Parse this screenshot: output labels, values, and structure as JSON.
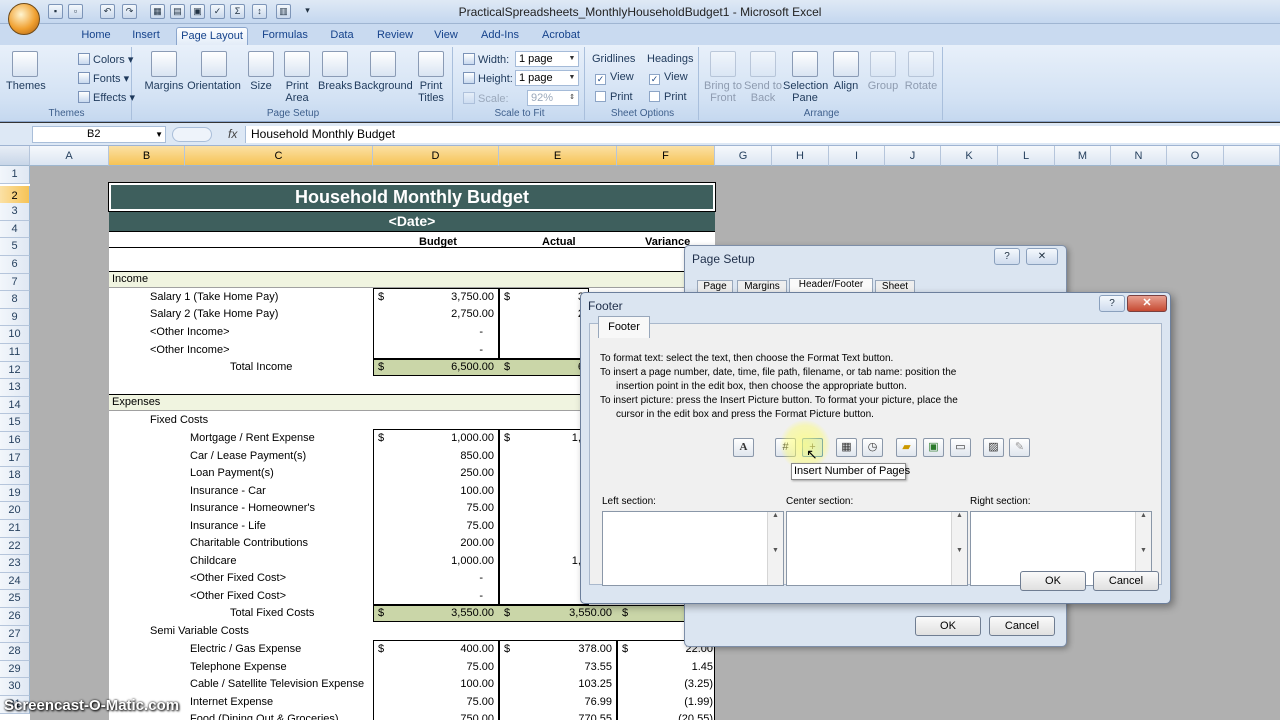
{
  "window": {
    "title": "PracticalSpreadsheets_MonthlyHouseholdBudget1 - Microsoft Excel",
    "qat": [
      "save-icon",
      "pdf-icon",
      "undo-icon",
      "redo-icon",
      "sort-icon",
      "open-icon",
      "print-preview-icon",
      "spellcheck-icon",
      "sum-icon",
      "sort-asc-icon",
      "insert-icon",
      "customize-icon"
    ]
  },
  "ribbon": {
    "tabs": [
      "Home",
      "Insert",
      "Page Layout",
      "Formulas",
      "Data",
      "Review",
      "View",
      "Add-Ins",
      "Acrobat"
    ],
    "active_tab": "Page Layout",
    "themes": {
      "label": "Themes",
      "colors": "Colors",
      "fonts": "Fonts",
      "effects": "Effects",
      "group": "Themes"
    },
    "page_setup": {
      "margins": "Margins",
      "orientation": "Orientation",
      "size": "Size",
      "print_area_1": "Print",
      "print_area_2": "Area",
      "breaks": "Breaks",
      "background": "Background",
      "print_titles_1": "Print",
      "print_titles_2": "Titles",
      "group": "Page Setup"
    },
    "scale_to_fit": {
      "width_label": "Width:",
      "width_value": "1 page",
      "height_label": "Height:",
      "height_value": "1 page",
      "scale_label": "Scale:",
      "scale_value": "92%",
      "group": "Scale to Fit"
    },
    "sheet_options": {
      "gridlines": "Gridlines",
      "headings": "Headings",
      "view": "View",
      "print": "Print",
      "group": "Sheet Options"
    },
    "arrange": {
      "bring_1": "Bring to",
      "bring_2": "Front",
      "send_1": "Send to",
      "send_2": "Back",
      "selection_1": "Selection",
      "selection_2": "Pane",
      "align": "Align",
      "grp": "Group",
      "rotate": "Rotate",
      "group": "Arrange"
    }
  },
  "formula_bar": {
    "name_box": "B2",
    "fx": "fx",
    "formula": "Household Monthly Budget"
  },
  "columns": [
    "A",
    "B",
    "C",
    "D",
    "E",
    "F",
    "G",
    "H",
    "I",
    "J",
    "K",
    "L",
    "M",
    "N",
    "O"
  ],
  "rows": [
    "1",
    "2",
    "3",
    "4",
    "5",
    "6",
    "7",
    "8",
    "9",
    "10",
    "11",
    "12",
    "13",
    "14",
    "15",
    "16",
    "17",
    "18",
    "19",
    "20",
    "21",
    "22",
    "23",
    "24",
    "25",
    "26",
    "27",
    "28",
    "29",
    "30",
    "31"
  ],
  "sheet": {
    "title": "Household Monthly Budget",
    "date": "<Date>",
    "headers": {
      "budget": "Budget",
      "actual": "Actual",
      "variance": "Variance"
    },
    "income": "Income",
    "salary1": "Salary 1 (Take Home Pay)",
    "salary2": "Salary 2 (Take Home Pay)",
    "other_income1": "<Other Income>",
    "other_income2": "<Other Income>",
    "total_income": "Total Income",
    "expenses": "Expenses",
    "fixed_costs": "Fixed Costs",
    "semi_variable": "Semi Variable Costs",
    "total_fixed": "Total Fixed Costs",
    "dollar": "$",
    "dash": "-",
    "fixed_items": [
      {
        "name": "Mortgage / Rent Expense",
        "budget": "1,000.00",
        "actual": "1,0"
      },
      {
        "name": "Car / Lease Payment(s)",
        "budget": "850.00",
        "actual": ""
      },
      {
        "name": "Loan Payment(s)",
        "budget": "250.00",
        "actual": ""
      },
      {
        "name": "Insurance - Car",
        "budget": "100.00",
        "actual": ""
      },
      {
        "name": "Insurance - Homeowner's",
        "budget": "75.00",
        "actual": ""
      },
      {
        "name": "Insurance - Life",
        "budget": "75.00",
        "actual": ""
      },
      {
        "name": "Charitable Contributions",
        "budget": "200.00",
        "actual": ""
      },
      {
        "name": "Childcare",
        "budget": "1,000.00",
        "actual": "1,0"
      },
      {
        "name": "<Other Fixed Cost>",
        "budget": "-",
        "actual": ""
      },
      {
        "name": "<Other Fixed Cost>",
        "budget": "-",
        "actual": ""
      }
    ],
    "values": {
      "salary1_budget": "3,750.00",
      "salary1_actual": "3,",
      "salary2_budget": "2,750.00",
      "salary2_actual": "2,",
      "total_income_budget": "6,500.00",
      "total_income_actual": "6,",
      "total_fixed_budget": "3,550.00",
      "total_fixed_actual": "3,550.00"
    },
    "semi_items": [
      {
        "name": "Electric / Gas Expense",
        "budget": "400.00",
        "actual": "378.00",
        "variance": "22.00"
      },
      {
        "name": "Telephone Expense",
        "budget": "75.00",
        "actual": "73.55",
        "variance": "1.45"
      },
      {
        "name": "Cable / Satellite Television Expense",
        "budget": "100.00",
        "actual": "103.25",
        "variance": "(3.25)"
      },
      {
        "name": "Internet Expense",
        "budget": "75.00",
        "actual": "76.99",
        "variance": "(1.99)"
      },
      {
        "name": "Food (Dining Out & Groceries)",
        "budget": "750.00",
        "actual": "770.55",
        "variance": "(20.55)"
      }
    ]
  },
  "page_setup_dialog": {
    "title": "Page Setup",
    "tabs": [
      "Page",
      "Margins",
      "Header/Footer",
      "Sheet"
    ],
    "help": "?",
    "close": "✕",
    "ok": "OK",
    "cancel": "Cancel"
  },
  "footer_dialog": {
    "title": "Footer",
    "tab": "Footer",
    "help": "?",
    "close": "✕",
    "instructions": [
      "To format text:  select the text, then choose the Format Text button.",
      "To insert a page number, date, time, file path, filename, or tab name:  position the",
      "     insertion point in the edit box, then choose the appropriate button.",
      "To insert picture: press the Insert Picture button.  To format your picture, place the",
      "     cursor in the edit box and press the Format Picture button."
    ],
    "left_section": "Left section:",
    "center_section": "Center section:",
    "right_section": "Right section:",
    "tooltip": "Insert Number of Pages",
    "ok": "OK",
    "cancel": "Cancel"
  },
  "watermark": "Screencast-O-Matic.com"
}
